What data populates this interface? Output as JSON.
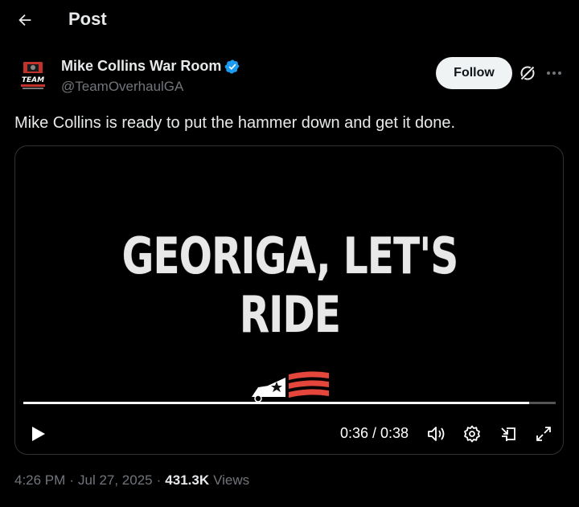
{
  "header": {
    "title": "Post",
    "back_icon": "arrow-left-icon"
  },
  "author": {
    "display_name": "Mike Collins War Room",
    "handle": "@TeamOverhaulGA",
    "avatar_text": "TEAM",
    "verified": true,
    "verified_color": "#1d9bf0"
  },
  "actions": {
    "follow_label": "Follow",
    "grok_icon": "grok-icon",
    "more_icon": "more-dots-icon"
  },
  "tweet": {
    "text": "Mike Collins is ready to put the hammer down and get it done."
  },
  "video": {
    "frame_text": "GEORIGA, LET'S RIDE",
    "current_time": "0:36",
    "duration": "0:38",
    "time_display": "0:36 / 0:38",
    "progress": 0.95,
    "controls": [
      "play-icon",
      "volume-icon",
      "settings-icon",
      "pip-icon",
      "fullscreen-icon"
    ]
  },
  "meta": {
    "time": "4:26 PM",
    "date": "Jul 27, 2025",
    "views_count": "431.3K",
    "views_label": "Views"
  },
  "colors": {
    "background": "#000000",
    "text_primary": "#e7e9ea",
    "text_secondary": "#71767b",
    "follow_bg": "#eff3f4",
    "flag_red": "#e4463b"
  }
}
